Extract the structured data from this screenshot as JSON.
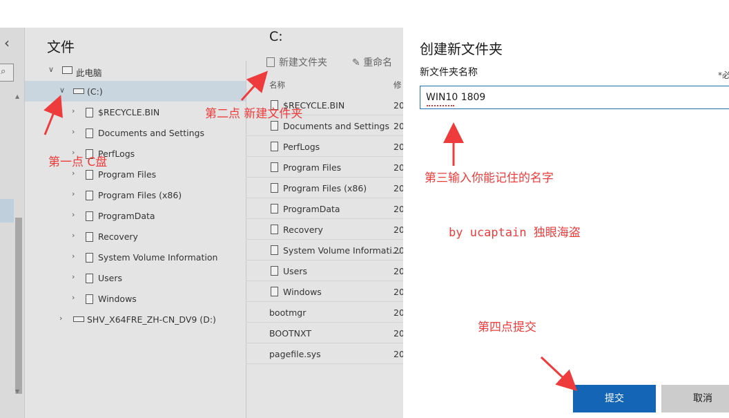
{
  "explorer": {
    "back_icon": "chevron-left-icon",
    "search_icon": "search-icon",
    "pane_title": "文件",
    "tree": [
      {
        "label": "此电脑",
        "icon": "computer-icon",
        "level": 0,
        "expanded": true
      },
      {
        "label": "(C:)",
        "icon": "drive-icon",
        "level": 1,
        "expanded": true,
        "selected": true
      },
      {
        "label": "$RECYCLE.BIN",
        "icon": "folder-icon",
        "level": 2
      },
      {
        "label": "Documents and Settings",
        "icon": "folder-icon",
        "level": 2
      },
      {
        "label": "PerfLogs",
        "icon": "folder-icon",
        "level": 2
      },
      {
        "label": "Program Files",
        "icon": "folder-icon",
        "level": 2
      },
      {
        "label": "Program Files (x86)",
        "icon": "folder-icon",
        "level": 2
      },
      {
        "label": "ProgramData",
        "icon": "folder-icon",
        "level": 2
      },
      {
        "label": "Recovery",
        "icon": "folder-icon",
        "level": 2
      },
      {
        "label": "System Volume Information",
        "icon": "folder-icon",
        "level": 2
      },
      {
        "label": "Users",
        "icon": "folder-icon",
        "level": 2
      },
      {
        "label": "Windows",
        "icon": "folder-icon",
        "level": 2
      },
      {
        "label": "SHV_X64FRE_ZH-CN_DV9 (D:)",
        "icon": "drive-icon",
        "level": 1
      }
    ],
    "current_path": "C:",
    "toolbar": {
      "new_folder": "新建文件夹",
      "rename": "重命名"
    },
    "columns": {
      "name": "名称",
      "modified": "修"
    },
    "files": [
      {
        "name": "$RECYCLE.BIN",
        "icon": "folder-icon",
        "modified": "20"
      },
      {
        "name": "Documents and Settings",
        "icon": "folder-icon",
        "modified": "20"
      },
      {
        "name": "PerfLogs",
        "icon": "folder-icon",
        "modified": "20"
      },
      {
        "name": "Program Files",
        "icon": "folder-icon",
        "modified": "20"
      },
      {
        "name": "Program Files (x86)",
        "icon": "folder-icon",
        "modified": "20"
      },
      {
        "name": "ProgramData",
        "icon": "folder-icon",
        "modified": "20"
      },
      {
        "name": "Recovery",
        "icon": "folder-icon",
        "modified": "20"
      },
      {
        "name": "System Volume Informati...",
        "icon": "folder-icon",
        "modified": "20"
      },
      {
        "name": "Users",
        "icon": "folder-icon",
        "modified": "20"
      },
      {
        "name": "Windows",
        "icon": "folder-icon",
        "modified": "20"
      },
      {
        "name": "bootmgr",
        "icon": null,
        "modified": "20"
      },
      {
        "name": "BOOTNXT",
        "icon": null,
        "modified": "20"
      },
      {
        "name": "pagefile.sys",
        "icon": null,
        "modified": "20"
      }
    ]
  },
  "dialog": {
    "title": "创建新文件夹",
    "field_label": "新文件夹名称",
    "required_mark": "*必",
    "input_value": "WIN10 1809",
    "submit_label": "提交",
    "cancel_label": "取消",
    "accent_color": "#1465b5"
  },
  "annotations": {
    "step1": "第一点  C盘",
    "step2": "第二点  新建文件夹",
    "step3": "第三输入你能记住的名字",
    "credit": "by ucaptain 独眼海盗",
    "step4": "第四点提交",
    "color": "#ee3b3b"
  }
}
